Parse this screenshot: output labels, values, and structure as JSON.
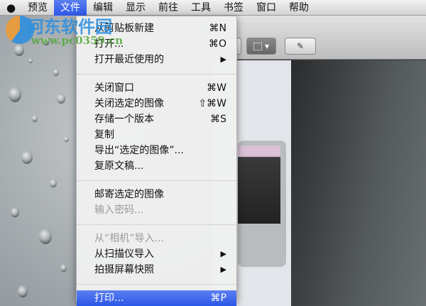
{
  "menubar": {
    "apple": "",
    "items": [
      "预览",
      "文件",
      "编辑",
      "显示",
      "前往",
      "工具",
      "书签",
      "窗口",
      "帮助"
    ],
    "active_index": 1
  },
  "file_menu": {
    "items": [
      {
        "label": "从剪贴板新建",
        "shortcut": "⌘N"
      },
      {
        "label": "打开...",
        "shortcut": "⌘O"
      },
      {
        "label": "打开最近使用的",
        "submenu": "▶"
      },
      {
        "sep": true
      },
      {
        "label": "关闭窗口",
        "shortcut": "⌘W"
      },
      {
        "label": "关闭选定的图像",
        "shortcut": "⇧⌘W"
      },
      {
        "label": "存储一个版本",
        "shortcut": "⌘S"
      },
      {
        "label": "复制"
      },
      {
        "label": "导出“选定的图像”..."
      },
      {
        "label": "复原文稿..."
      },
      {
        "sep": true
      },
      {
        "label": "邮寄选定的图像"
      },
      {
        "label": "输入密码...",
        "disabled": true
      },
      {
        "sep": true
      },
      {
        "label": "从“相机”导入...",
        "disabled": true
      },
      {
        "label": "从扫描仪导入",
        "submenu": "▶"
      },
      {
        "label": "拍摄屏幕快照",
        "submenu": "▶"
      },
      {
        "sep": true
      },
      {
        "label": "打印...",
        "shortcut": "⌘P",
        "highlighted": true
      }
    ]
  },
  "toolbar": {
    "select_icon": "selection-rect-icon",
    "dropdown": "▾",
    "annotate_icon": "pencil-icon"
  },
  "watermark": {
    "name": "河东软件园",
    "url": "www.pc0359.cn"
  }
}
